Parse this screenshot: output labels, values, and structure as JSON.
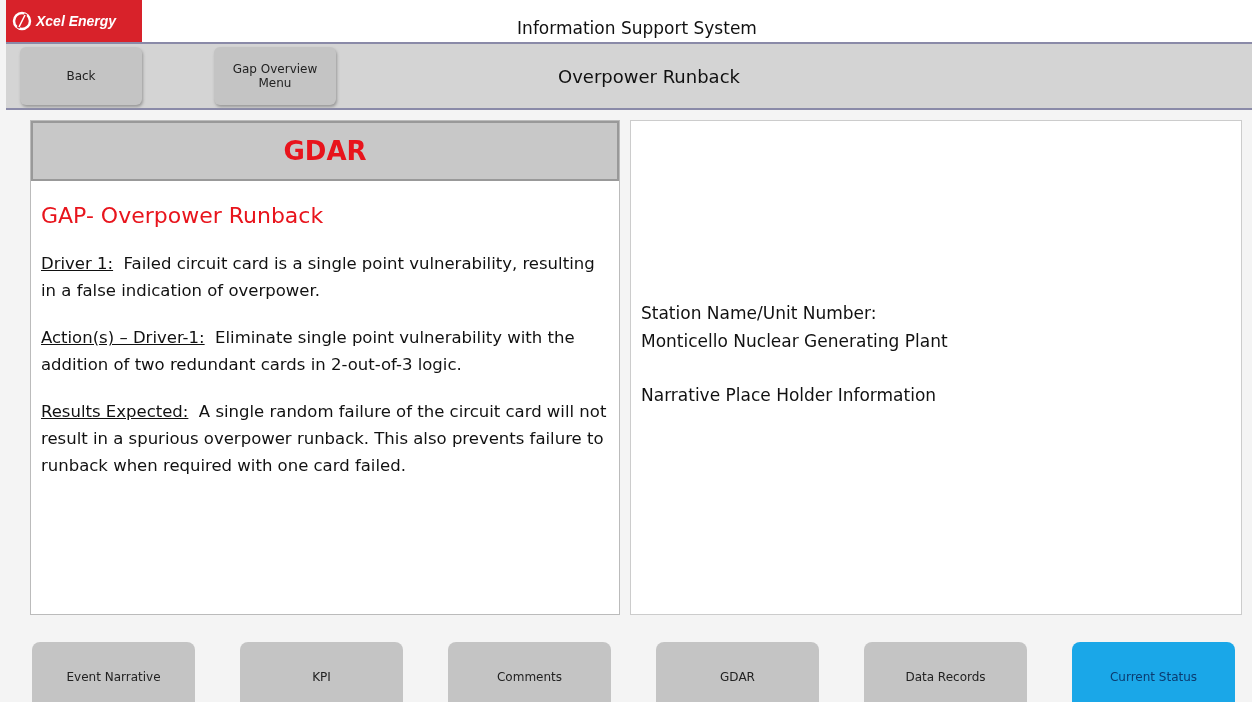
{
  "header": {
    "logo": "Xcel Energy",
    "title": "Information Support System"
  },
  "toolbar": {
    "buttons": [
      "Back",
      "Gap Overview Menu"
    ],
    "title": "Overpower Runback"
  },
  "gdar_panel": {
    "heading": "GDAR",
    "title": "GAP- Overpower Runback",
    "sections": [
      {
        "label": "Driver 1:",
        "text": "Failed circuit card is a single point vulnerability, resulting in a false indication of overpower."
      },
      {
        "label": "Action(s) – Driver-1:",
        "text": "Eliminate single point vulnerability with the addition of two redundant cards in 2-out-of-3 logic."
      },
      {
        "label": "Results Expected:",
        "text": "A single random failure of the circuit card will not result in a spurious overpower runback.  This also prevents failure to runback when required with one card failed."
      }
    ]
  },
  "narrative_panel": {
    "station_label": "Station Name/Unit Number:",
    "station_name": "Monticello Nuclear Generating Plant",
    "narrative": "Narrative Place Holder Information"
  },
  "tabs": [
    {
      "label": "Event Narrative",
      "selected": false
    },
    {
      "label": "KPI",
      "selected": false
    },
    {
      "label": "Comments",
      "selected": false
    },
    {
      "label": "GDAR",
      "selected": false
    },
    {
      "label": "Data Records",
      "selected": false
    },
    {
      "label": "Current Status",
      "selected": true
    }
  ]
}
